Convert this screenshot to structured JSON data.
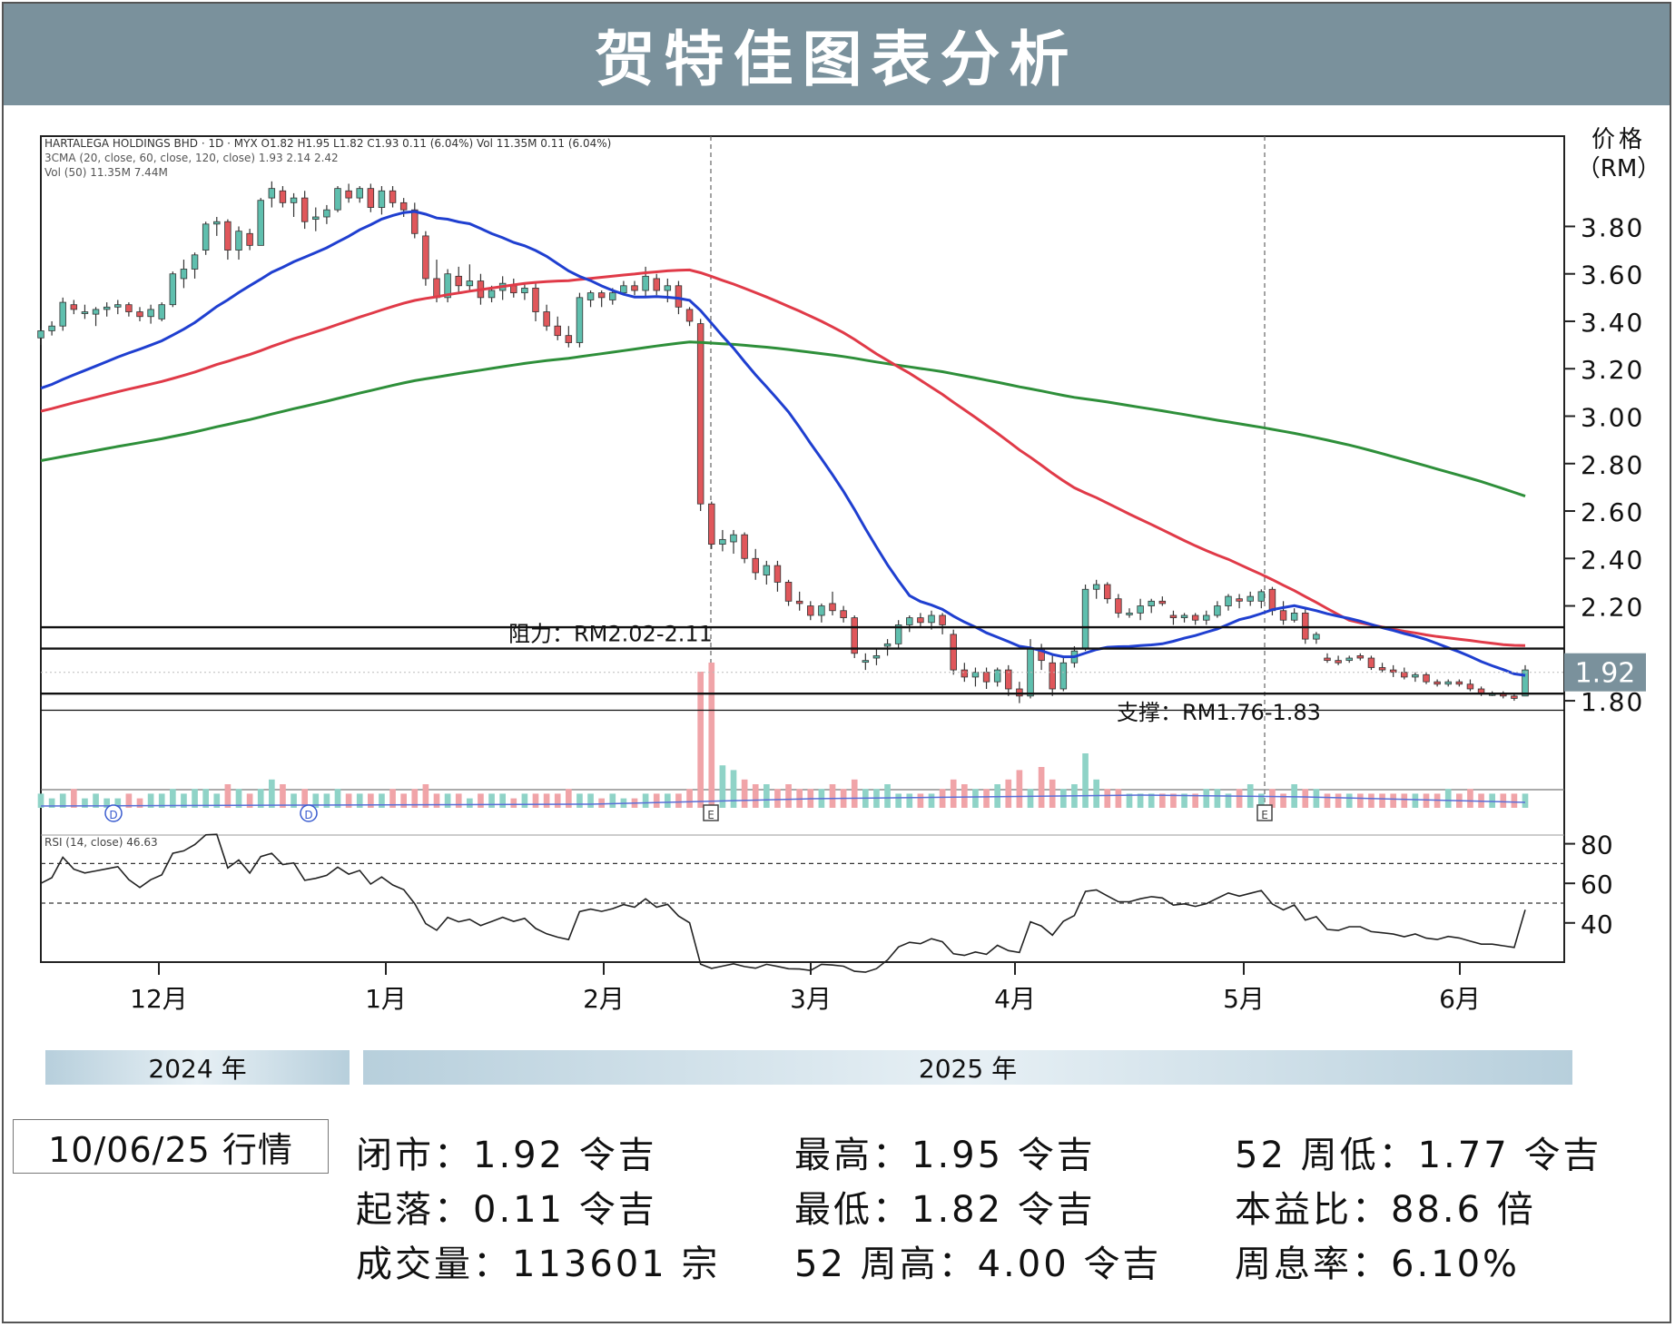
{
  "header": {
    "title": "贺特佳图表分析"
  },
  "chart_data": {
    "type": "candlestick",
    "info_lines": [
      "HARTALEGA HOLDINGS BHD · 1D · MYX  O1.82  H1.95  L1.82  C1.93  0.11 (6.04%)  Vol 11.35M  0.11 (6.04%)",
      "3CMA (20, close, 60, close, 120, close)  1.93  2.14  2.42",
      "Vol (50)  11.35M  7.44M"
    ],
    "rsi_label": "RSI (14, close)  46.63",
    "y_axis_title": [
      "价格",
      "（RM）"
    ],
    "y_ticks": [
      "3.80",
      "3.60",
      "3.40",
      "3.20",
      "3.00",
      "2.80",
      "2.60",
      "2.40",
      "2.20",
      "1.80"
    ],
    "rsi_ticks": [
      "80",
      "60",
      "40"
    ],
    "current_price": "1.92",
    "x_months": [
      "12月",
      "1月",
      "2月",
      "3月",
      "4月",
      "5月",
      "6月"
    ],
    "event_markers": [
      "D",
      "D",
      "E",
      "E"
    ],
    "resistance_label": "阻力：RM2.02-2.11",
    "support_label": "支撑：RM1.76-1.83",
    "resistance_range": [
      2.02,
      2.11
    ],
    "support_range": [
      1.76,
      1.83
    ],
    "last_rsi": 46.63,
    "ma_last": {
      "ma20": 1.93,
      "ma60": 2.14,
      "ma120": 2.42
    },
    "colors": {
      "up": "#5fbfae",
      "down": "#e0575b",
      "ma20": "#1f3fd0",
      "ma60": "#e03a48",
      "ma120": "#2e8f3a",
      "vol_up": "#8fd3c7",
      "vol_down": "#f0a4a8"
    }
  },
  "year_labels": {
    "y2024": "2024 年",
    "y2025": "2025 年"
  },
  "date_label": "10/06/25 行情",
  "stats": [
    "闭市：1.92 令吉",
    "最高：1.95 令吉",
    "52 周低：1.77 令吉",
    "起落：0.11 令吉",
    "最低：1.82 令吉",
    "本益比：88.6 倍",
    "成交量：113601 宗",
    "52 周高：4.00 令吉",
    "周息率：6.10%"
  ]
}
